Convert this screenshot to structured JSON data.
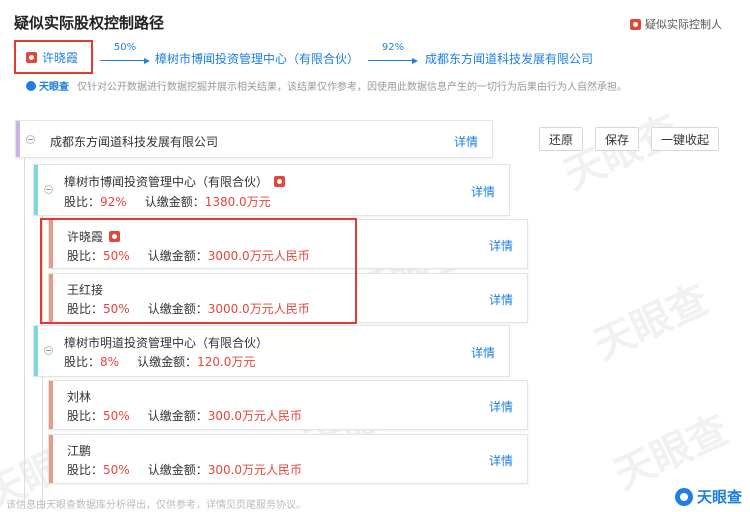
{
  "header": {
    "title": "疑似实际股权控制路径",
    "legend_label": "疑似实际控制人"
  },
  "path": {
    "start": "许晓霞",
    "step1_pct": "50%",
    "step1_name": "樟树市博闻投资管理中心（有限合伙）",
    "step2_pct": "92%",
    "step2_name": "成都东方闻道科技发展有限公司"
  },
  "disclaimer": {
    "brand": "天眼查",
    "text": "仅针对公开数据进行数据挖掘并展示相关结果，该结果仅作参考，因使用此数据信息产生的一切行为后果由行为人自然承担。"
  },
  "toolbar": {
    "restore": "还原",
    "save": "保存",
    "collapse_all": "一键收起"
  },
  "tree": {
    "root": {
      "name": "成都东方闻道科技发展有限公司",
      "detail": "详情"
    },
    "nodes": [
      {
        "name": "樟树市博闻投资管理中心（有限合伙）",
        "ratio_label": "股比：",
        "ratio": "92%",
        "amount_label": "认缴金额：",
        "amount": "1380.0万元",
        "detail": "详情"
      },
      {
        "name": "许晓霞",
        "ratio_label": "股比：",
        "ratio": "50%",
        "amount_label": "认缴金额：",
        "amount": "3000.0万元人民币",
        "detail": "详情"
      },
      {
        "name": "王红接",
        "ratio_label": "股比：",
        "ratio": "50%",
        "amount_label": "认缴金额：",
        "amount": "3000.0万元人民币",
        "detail": "详情"
      },
      {
        "name": "樟树市明道投资管理中心（有限合伙）",
        "ratio_label": "股比：",
        "ratio": "8%",
        "amount_label": "认缴金额：",
        "amount": "120.0万元",
        "detail": "详情"
      },
      {
        "name": "刘林",
        "ratio_label": "股比：",
        "ratio": "50%",
        "amount_label": "认缴金额：",
        "amount": "300.0万元人民币",
        "detail": "详情"
      },
      {
        "name": "江鹏",
        "ratio_label": "股比：",
        "ratio": "50%",
        "amount_label": "认缴金额：",
        "amount": "300.0万元人民币",
        "detail": "详情"
      }
    ]
  },
  "footer": {
    "note": "该信息由天眼查数据库分析得出，仅供参考，详情见页尾服务协议。",
    "brand": "天眼查"
  },
  "watermark_text": "天眼查",
  "colors": {
    "accent_blue": "#1e7fe0",
    "value_red": "#e4463b",
    "highlight_red": "#e33a2f",
    "root_bar": "#c8b4e6",
    "company_bar": "#7fd7dd",
    "person_bar": "#e79a86"
  }
}
